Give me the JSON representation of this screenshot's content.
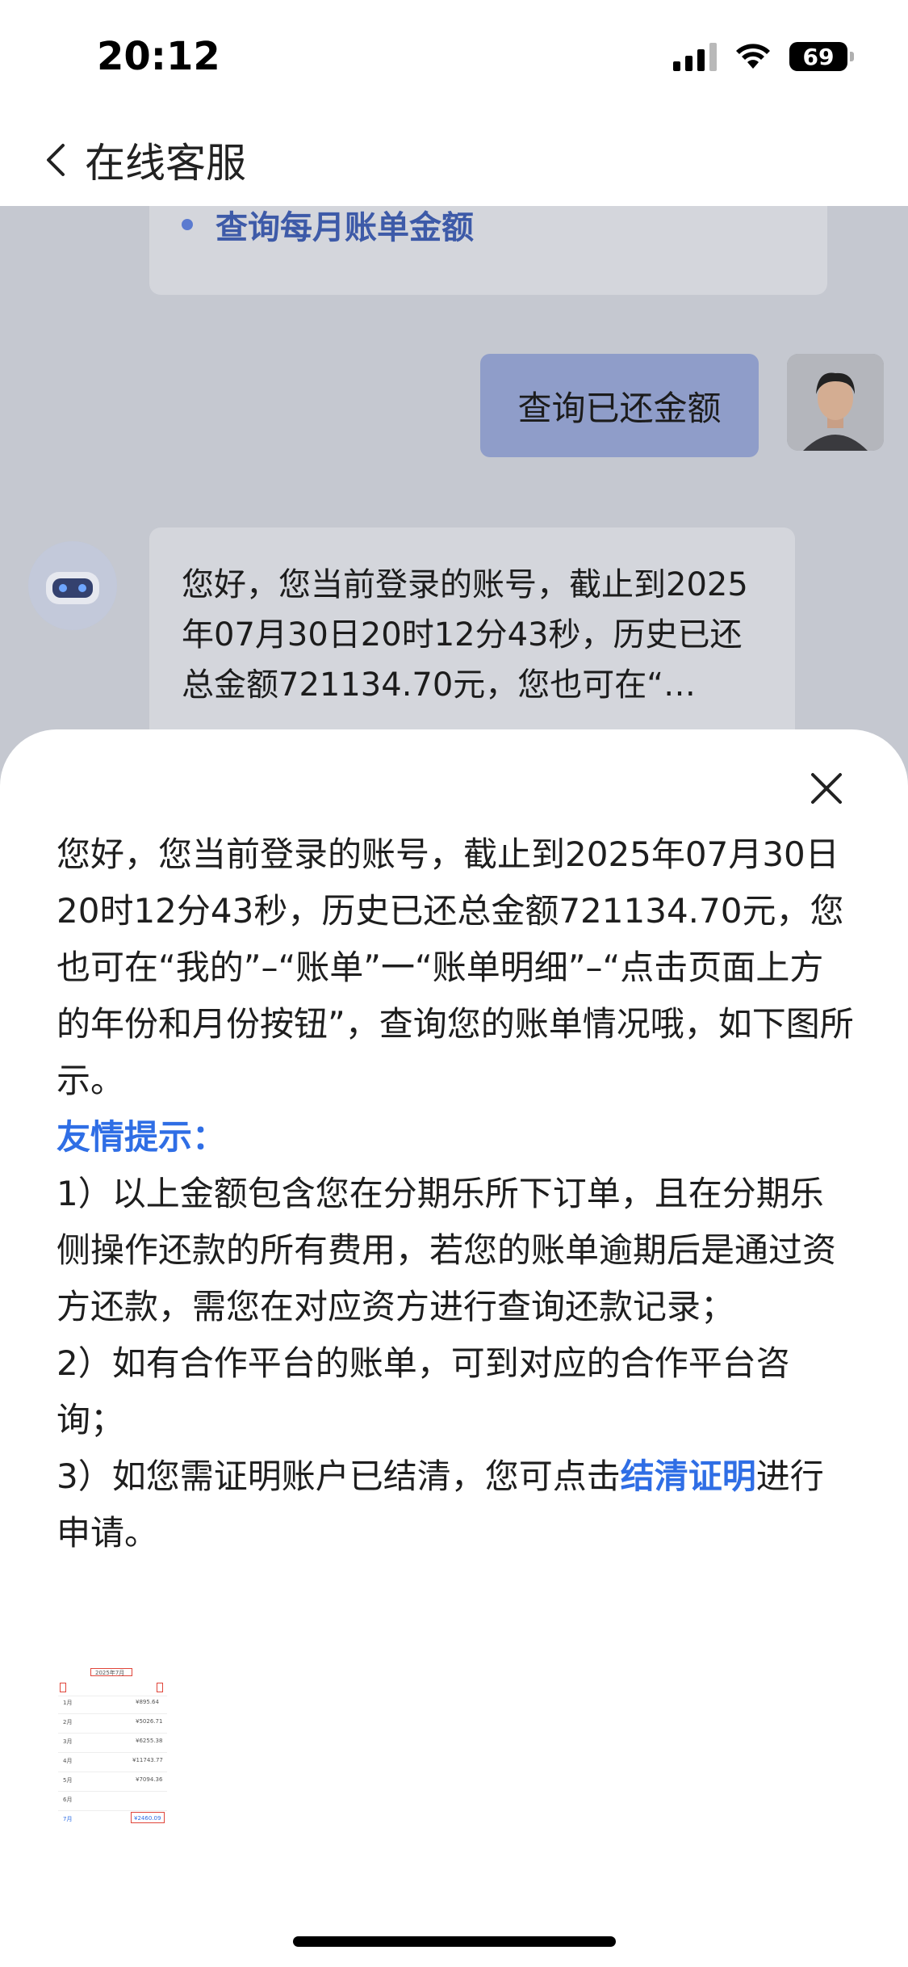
{
  "status_bar": {
    "time": "20:12",
    "battery": "69"
  },
  "nav": {
    "title": "在线客服"
  },
  "chat": {
    "top_link": "查询每月账单金额",
    "user_message": "查询已还金额",
    "bot_message_preview": "您好，您当前登录的账号，截止到2025年07月30日20时12分43秒，历史已还总金额721134.70元，您也可在“…"
  },
  "sheet": {
    "paragraph": "您好，您当前登录的账号，截止到2025年07月30日20时12分43秒，历史已还总金额721134.70元，您也可在“我的”–“账单”一“账单明细”–“点击页面上方的年份和月份按钮”，查询您的账单情况哦，如下图所示。",
    "tip_title": "友情提示：",
    "tip1": "1）以上金额包含您在分期乐所下订单，且在分期乐侧操作还款的所有费用，若您的账单逾期后是通过资方还款，需您在对应资方进行查询还款记录；",
    "tip2": "2）如有合作平台的账单，可到对应的合作平台咨询；",
    "tip3_prefix": "3）如您需证明账户已结清，您可点击",
    "tip3_link": "结清证明",
    "tip3_suffix": "进行申请。"
  },
  "thumbnail": {
    "header": "2025年7月",
    "rows": [
      {
        "month": "1月",
        "amount": "¥895.64"
      },
      {
        "month": "2月",
        "amount": "¥5026.71"
      },
      {
        "month": "3月",
        "amount": "¥6255.38"
      },
      {
        "month": "4月",
        "amount": "¥11743.77"
      },
      {
        "month": "5月",
        "amount": "¥7094.36"
      },
      {
        "month": "6月",
        "amount": ""
      },
      {
        "month": "7月",
        "amount": "¥2460.09"
      }
    ]
  },
  "colors": {
    "accent": "#2f6ee5",
    "user_bubble": "#8f9dc9",
    "overlay_bg": "#c5c8d0"
  }
}
